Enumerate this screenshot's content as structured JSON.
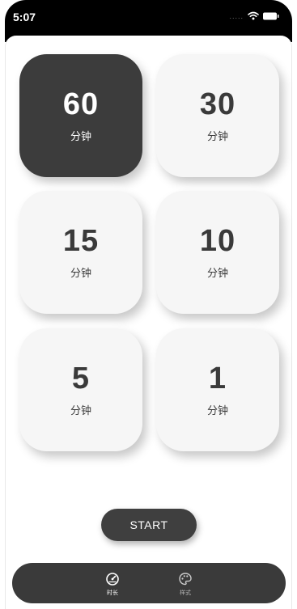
{
  "status_bar": {
    "time": "5:07",
    "signal": "....."
  },
  "timer_options": [
    {
      "value": "60",
      "unit": "分钟",
      "selected": true
    },
    {
      "value": "30",
      "unit": "分钟",
      "selected": false
    },
    {
      "value": "15",
      "unit": "分钟",
      "selected": false
    },
    {
      "value": "10",
      "unit": "分钟",
      "selected": false
    },
    {
      "value": "5",
      "unit": "分钟",
      "selected": false
    },
    {
      "value": "1",
      "unit": "分钟",
      "selected": false
    }
  ],
  "start_button": {
    "label": "START"
  },
  "tab_bar": {
    "tabs": [
      {
        "label": "时长",
        "icon": "speedometer-icon",
        "active": true
      },
      {
        "label": "样式",
        "icon": "palette-icon",
        "active": false
      }
    ]
  },
  "colors": {
    "active_tile": "#3c3c3c",
    "tile": "#f6f6f6",
    "button": "#3f3f3f",
    "tab_bar": "#3a3a3a"
  }
}
